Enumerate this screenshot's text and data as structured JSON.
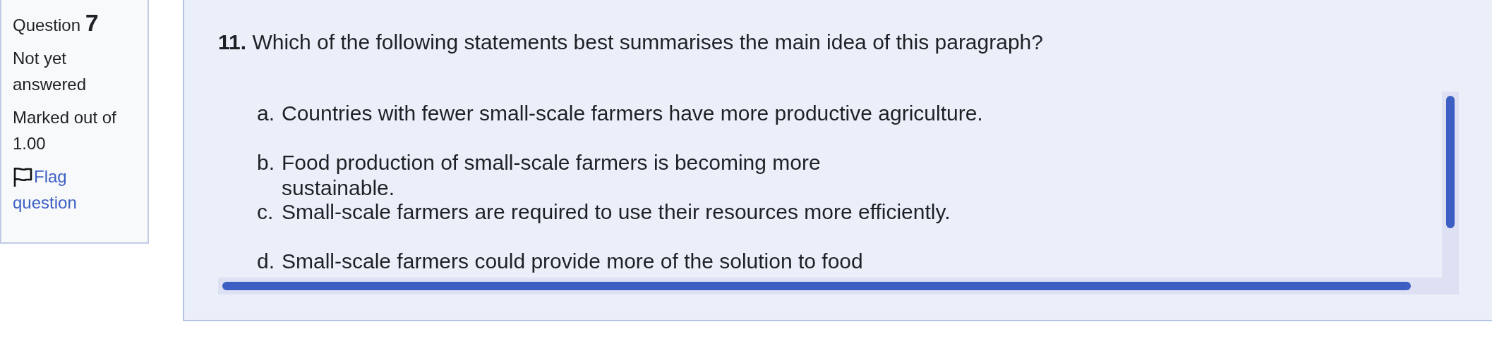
{
  "info": {
    "question_label": "Question",
    "question_number": "7",
    "status": "Not yet answered",
    "marks": "Marked out of 1.00",
    "flag_link": "Flag question"
  },
  "question": {
    "number": "11.",
    "text": "Which of the following statements best summarises the main idea of this paragraph?",
    "options": [
      {
        "letter": "a.",
        "text": "Countries with fewer small-scale farmers have more productive agriculture."
      },
      {
        "letter": "b.",
        "text": "Food production of small-scale farmers is becoming more sustainable."
      },
      {
        "letter": "c.",
        "text": "Small-scale farmers are required to use their resources more efficiently."
      },
      {
        "letter": "d.",
        "text": "Small-scale farmers could provide more of the solution to food"
      }
    ]
  }
}
